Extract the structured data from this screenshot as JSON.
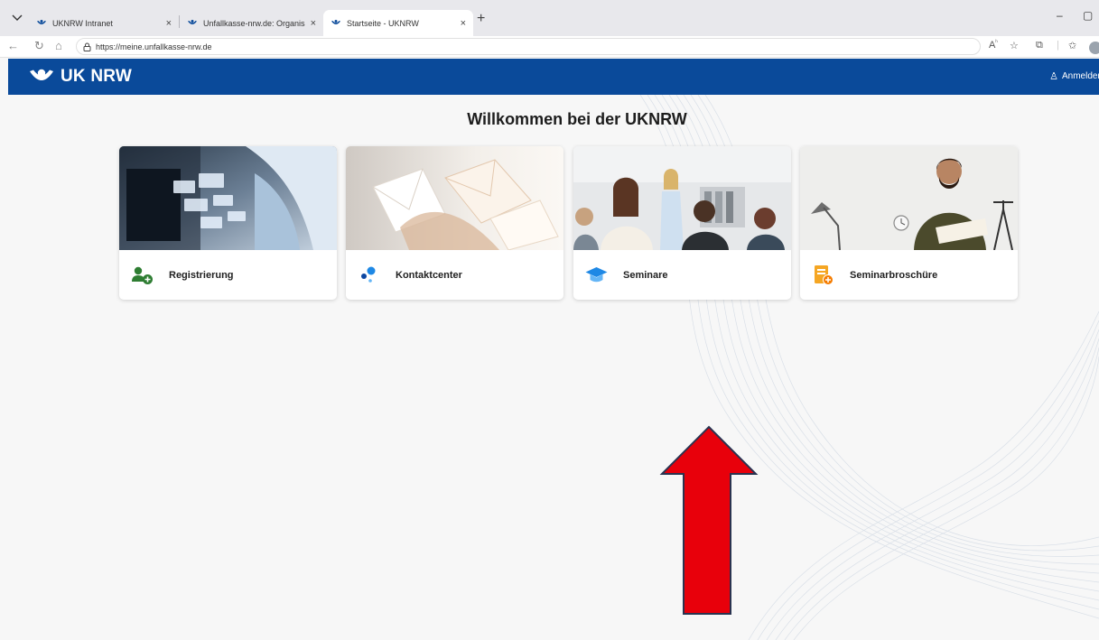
{
  "browser": {
    "tabs": [
      {
        "label": "UKNRW Intranet",
        "close": "×"
      },
      {
        "label": "Unfallkasse-nrw.de: Organisatoris",
        "close": "×"
      },
      {
        "label": "Startseite - UKNRW",
        "close": "×"
      }
    ],
    "new_tab": "+",
    "url": "https://meine.unfallkasse-nrw.de",
    "window": {
      "minimize": "–",
      "maximize": "▢"
    }
  },
  "header": {
    "brand": "UK NRW",
    "login_label": "Anmelden"
  },
  "main": {
    "title": "Willkommen bei der UKNRW",
    "cards": [
      {
        "label": "Registrierung",
        "icon": "add-user-icon",
        "icon_color": "#2e7d32"
      },
      {
        "label": "Kontaktcenter",
        "icon": "contact-dots-icon",
        "icon_color": "#1565c0"
      },
      {
        "label": "Seminare",
        "icon": "graduation-cap-icon",
        "icon_color": "#1e88e5"
      },
      {
        "label": "Seminarbroschüre",
        "icon": "brochure-icon",
        "icon_color": "#f5a623"
      }
    ]
  },
  "colors": {
    "header_bg": "#0a4a9a",
    "arrow_fill": "#e8000b",
    "arrow_stroke": "#2a3350"
  }
}
